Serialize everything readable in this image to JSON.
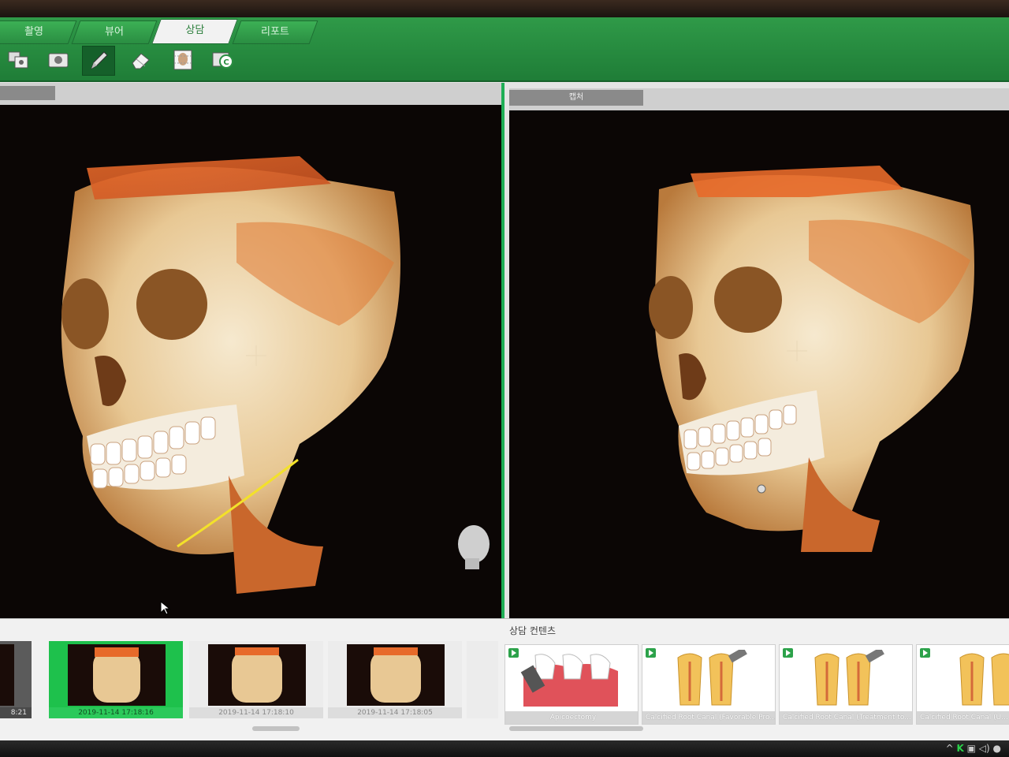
{
  "tabs": [
    {
      "label": "촬영"
    },
    {
      "label": "뷰어"
    },
    {
      "label": "상담"
    },
    {
      "label": "리포트"
    }
  ],
  "tools": [
    "compare-icon",
    "camera-icon",
    "pencil-icon",
    "eraser-icon",
    "face-grid-icon",
    "capture-icon"
  ],
  "right_view": {
    "header_tab": "캡처"
  },
  "thumbnails": [
    {
      "caption": "8:21"
    },
    {
      "caption": "2019-11-14 17:18:16"
    },
    {
      "caption": "2019-11-14 17:18:10"
    },
    {
      "caption": "2019-11-14 17:18:05"
    }
  ],
  "consult": {
    "title": "상담 컨텐츠",
    "cards": [
      {
        "caption": "Apicoectomy"
      },
      {
        "caption": "Calcified Root Canal (Favorable Pro..."
      },
      {
        "caption": "Calcified Root Canal (Treatment to..."
      },
      {
        "caption": "Calcified Root Canal (U..."
      }
    ]
  },
  "colors": {
    "accent": "#2a9a45",
    "selected": "#1ec14c"
  }
}
